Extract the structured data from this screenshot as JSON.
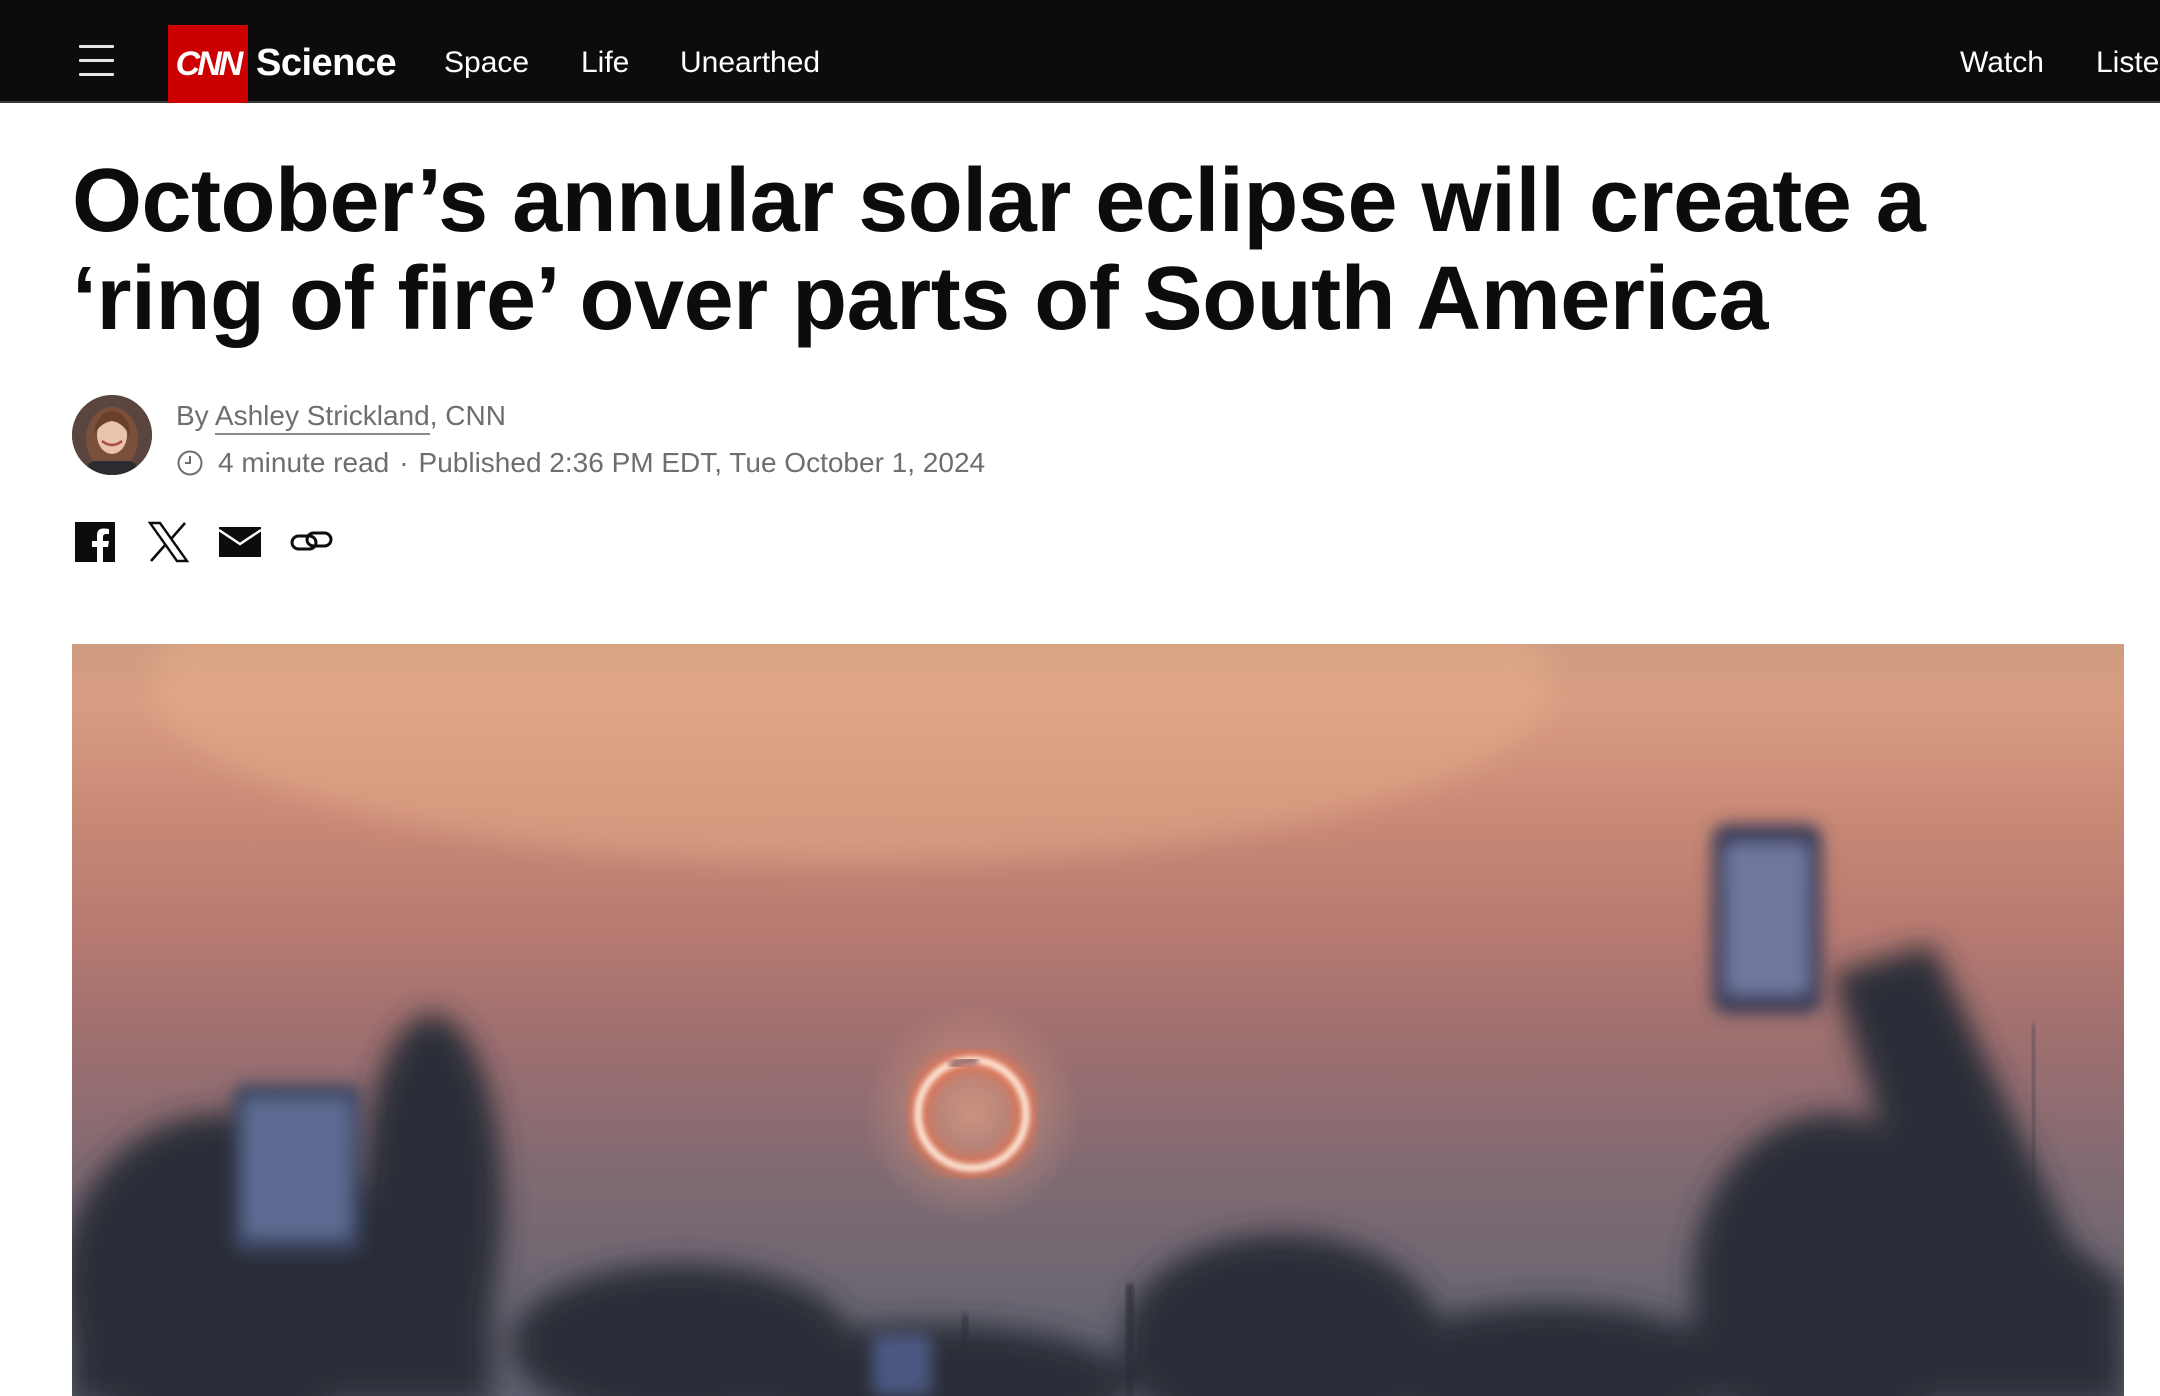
{
  "header": {
    "menu_icon": "hamburger-menu-icon",
    "logo_text": "CNN",
    "section": "Science",
    "nav": [
      "Space",
      "Life",
      "Unearthed"
    ],
    "right_nav": [
      "Watch",
      "Liste"
    ],
    "background_color": "#0c0c0c",
    "logo_color": "#cc0000"
  },
  "article": {
    "headline": "October’s annular solar eclipse will create a ‘ring of fire’ over parts of South America",
    "byline_prefix": "By",
    "author": "Ashley Strickland",
    "byline_suffix": ", CNN",
    "read_time": "4 minute read",
    "separator": "·",
    "published": "Published 2:36 PM EDT, Tue October 1, 2024"
  },
  "share": {
    "icons": [
      "facebook-icon",
      "x-icon",
      "email-icon",
      "link-icon"
    ]
  },
  "hero": {
    "description_colors": {
      "sky_top": "#d89c82",
      "sky_bottom": "#5e6270",
      "ring": "#ff7a4a"
    }
  }
}
